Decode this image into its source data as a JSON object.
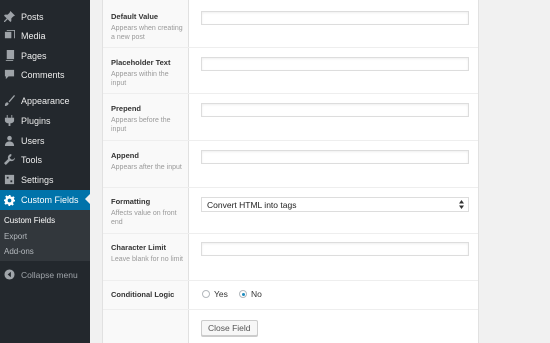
{
  "sidebar": {
    "items": [
      {
        "label": "Posts",
        "icon": "pin-icon"
      },
      {
        "label": "Media",
        "icon": "media-icon"
      },
      {
        "label": "Pages",
        "icon": "pages-icon"
      },
      {
        "label": "Comments",
        "icon": "comment-icon"
      },
      {
        "label": "Appearance",
        "icon": "brush-icon"
      },
      {
        "label": "Plugins",
        "icon": "plugin-icon"
      },
      {
        "label": "Users",
        "icon": "users-icon"
      },
      {
        "label": "Tools",
        "icon": "wrench-icon"
      },
      {
        "label": "Settings",
        "icon": "settings-icon"
      },
      {
        "label": "Custom Fields",
        "icon": "gear-icon",
        "active": true
      }
    ],
    "submenu": [
      "Custom Fields",
      "Export",
      "Add-ons"
    ],
    "collapse_label": "Collapse menu",
    "colors": {
      "background": "#23282d",
      "active": "#0073aa",
      "submenu": "#32373c"
    }
  },
  "fields": {
    "default_value": {
      "label": "Default Value",
      "desc": "Appears when creating a new post",
      "value": ""
    },
    "placeholder_text": {
      "label": "Placeholder Text",
      "desc": "Appears within the input",
      "value": ""
    },
    "prepend": {
      "label": "Prepend",
      "desc": "Appears before the input",
      "value": ""
    },
    "append": {
      "label": "Append",
      "desc": "Appears after the input",
      "value": ""
    },
    "formatting": {
      "label": "Formatting",
      "desc": "Affects value on front end",
      "selected": "Convert HTML into tags"
    },
    "character_limit": {
      "label": "Character Limit",
      "desc": "Leave blank for no limit",
      "value": ""
    },
    "conditional_logic": {
      "label": "Conditional Logic",
      "options": [
        "Yes",
        "No"
      ],
      "selected": "No"
    }
  },
  "close_button": "Close Field"
}
